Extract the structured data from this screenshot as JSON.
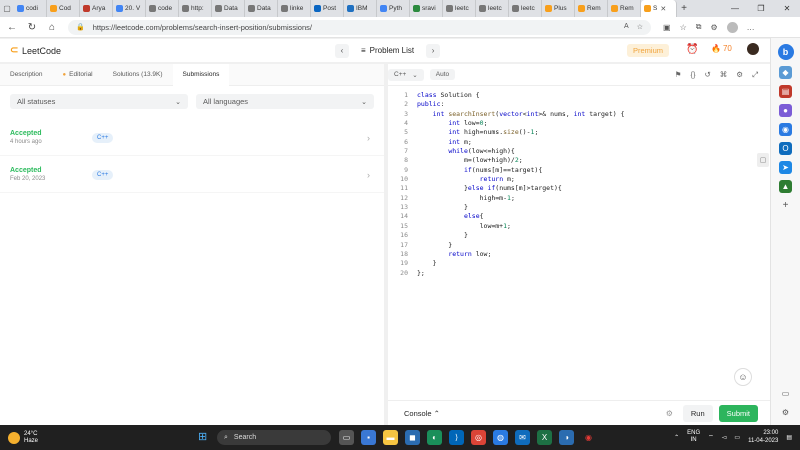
{
  "browser": {
    "tabs": [
      {
        "label": "codi",
        "color": "#4285f4"
      },
      {
        "label": "Cod",
        "color": "#f89f1b"
      },
      {
        "label": "Arya",
        "color": "#c0392b"
      },
      {
        "label": "20. V",
        "color": "#4285f4"
      },
      {
        "label": "code",
        "color": "#777777"
      },
      {
        "label": "http:",
        "color": "#777777"
      },
      {
        "label": "Data",
        "color": "#777777"
      },
      {
        "label": "Data",
        "color": "#777777"
      },
      {
        "label": "linke",
        "color": "#777777"
      },
      {
        "label": "Post",
        "color": "#0a66c2"
      },
      {
        "label": "IBM",
        "color": "#1f70c1"
      },
      {
        "label": "Pyth",
        "color": "#4285f4"
      },
      {
        "label": "sravi",
        "color": "#2b8a3e"
      },
      {
        "label": "leetc",
        "color": "#777777"
      },
      {
        "label": "leetc",
        "color": "#777777"
      },
      {
        "label": "leetc",
        "color": "#777777"
      },
      {
        "label": "Plus",
        "color": "#f89f1b"
      },
      {
        "label": "Rem",
        "color": "#f89f1b"
      },
      {
        "label": "Rem",
        "color": "#f89f1b"
      },
      {
        "label": "S",
        "color": "#f89f1b"
      }
    ],
    "new_tab": "+",
    "url": "https://leetcode.com/problems/search-insert-position/submissions/"
  },
  "header": {
    "logo": "LeetCode",
    "problem_list": "Problem List",
    "premium": "Premium",
    "streak": "70"
  },
  "left": {
    "tabs": [
      "Description",
      "Editorial",
      "Solutions (13.9K)",
      "Submissions"
    ],
    "filter_status": "All statuses",
    "filter_language": "All languages",
    "submissions": [
      {
        "status": "Accepted",
        "time": "4 hours ago",
        "lang": "C++"
      },
      {
        "status": "Accepted",
        "time": "Feb 20, 2023",
        "lang": "C++"
      }
    ]
  },
  "editor": {
    "language": "C++",
    "mode": "Auto",
    "lines": [
      "class Solution {",
      "public:",
      "    int searchInsert(vector<int>& nums, int target) {",
      "        int low=0;",
      "        int high=nums.size()-1;",
      "        int m;",
      "        while(low<=high){",
      "            m=(low+high)/2;",
      "            if(nums[m]==target){",
      "                return m;",
      "            }else if(nums[m]>target){",
      "                high=m-1;",
      "            }",
      "            else{",
      "                low=m+1;",
      "            }",
      "        }",
      "        return low;",
      "    }",
      "};"
    ],
    "console": "Console",
    "run": "Run",
    "submit": "Submit"
  },
  "taskbar": {
    "temp": "24°C",
    "weather": "Haze",
    "search": "Search",
    "lang": "ENG",
    "region": "IN",
    "time": "23:00",
    "date": "11-04-2023"
  }
}
